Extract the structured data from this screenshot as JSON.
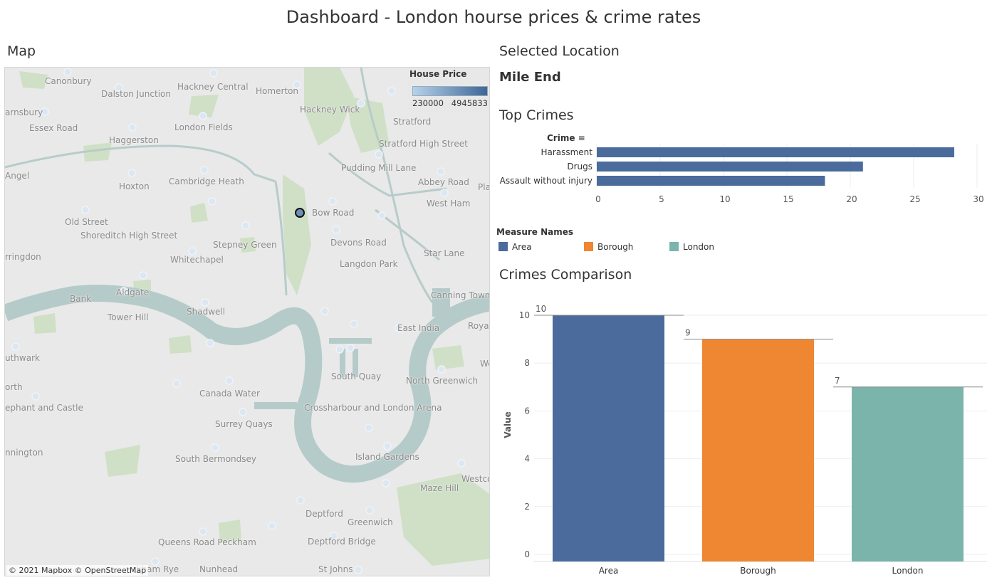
{
  "dashboard": {
    "title": "Dashboard - London hourse prices & crime rates"
  },
  "map": {
    "title": "Map",
    "legend": {
      "title": "House Price",
      "min": "230000",
      "max": "4945833"
    },
    "attribution_mapbox": "© 2021 Mapbox",
    "attribution_osm": "© OpenStreetMap",
    "places": [
      "Canonbury",
      "Dalston Junction",
      "Hackney Central",
      "Homerton",
      "arnsbury",
      "Hackney Wick",
      "Essex Road",
      "Haggerston",
      "London Fields",
      "Stratford",
      "Stratford High Street",
      "Angel",
      "Hoxton",
      "Cambridge Heath",
      "Pudding Mill Lane",
      "Abbey Road",
      "Pla",
      "West Ham",
      "Bow Road",
      "Old Street",
      "Shoreditch High Street",
      "Stepney Green",
      "Devons Road",
      "Star Lane",
      "rringdon",
      "Whitechapel",
      "Langdon Park",
      "Aldgate",
      "Bank",
      "Tower Hill",
      "Shadwell",
      "Canning Town",
      "Royal",
      "East India",
      "uthwark",
      "We",
      "orth",
      "South Quay",
      "North Greenwich",
      "Canada Water",
      "ephant and Castle",
      "Crossharbour and London Arena",
      "Surrey Quays",
      "nnington",
      "Island Gardens",
      "South Bermondsey",
      "Westco",
      "Maze Hill",
      "Deptford",
      "Greenwich",
      "Queens Road Peckham",
      "Deptford Bridge",
      "ckham Rye",
      "Nunhead",
      "St Johns"
    ]
  },
  "selected_location": {
    "title": "Selected Location",
    "name": "Mile End"
  },
  "top_crimes": {
    "title": "Top Crimes",
    "header": "Crime",
    "sort_icon": "sort-descending-icon"
  },
  "measure_legend": {
    "title": "Measure Names",
    "items": [
      {
        "label": "Area",
        "color": "#4a6b9c"
      },
      {
        "label": "Borough",
        "color": "#ef8631"
      },
      {
        "label": "London",
        "color": "#7ab4ab"
      }
    ]
  },
  "crimes_comparison": {
    "title": "Crimes Comparison"
  },
  "chart_data": [
    {
      "type": "bar",
      "orientation": "horizontal",
      "categories": [
        "Harassment",
        "Drugs",
        "Assault without injury"
      ],
      "values": [
        28.2,
        21,
        18
      ],
      "xticks": [
        "0",
        "5",
        "10",
        "15",
        "20",
        "25",
        "30"
      ],
      "xlim": [
        0,
        30
      ],
      "color": "#4a6b9c"
    },
    {
      "type": "bar",
      "categories": [
        "Area",
        "Borough",
        "London"
      ],
      "values": [
        10,
        9,
        7
      ],
      "data_labels": [
        "10",
        "9",
        "7"
      ],
      "colors": [
        "#4a6b9c",
        "#ef8631",
        "#7ab4ab"
      ],
      "ylabel": "Value",
      "yticks": [
        "0",
        "2",
        "4",
        "6",
        "8",
        "10"
      ],
      "ylim": [
        0,
        10
      ]
    }
  ]
}
